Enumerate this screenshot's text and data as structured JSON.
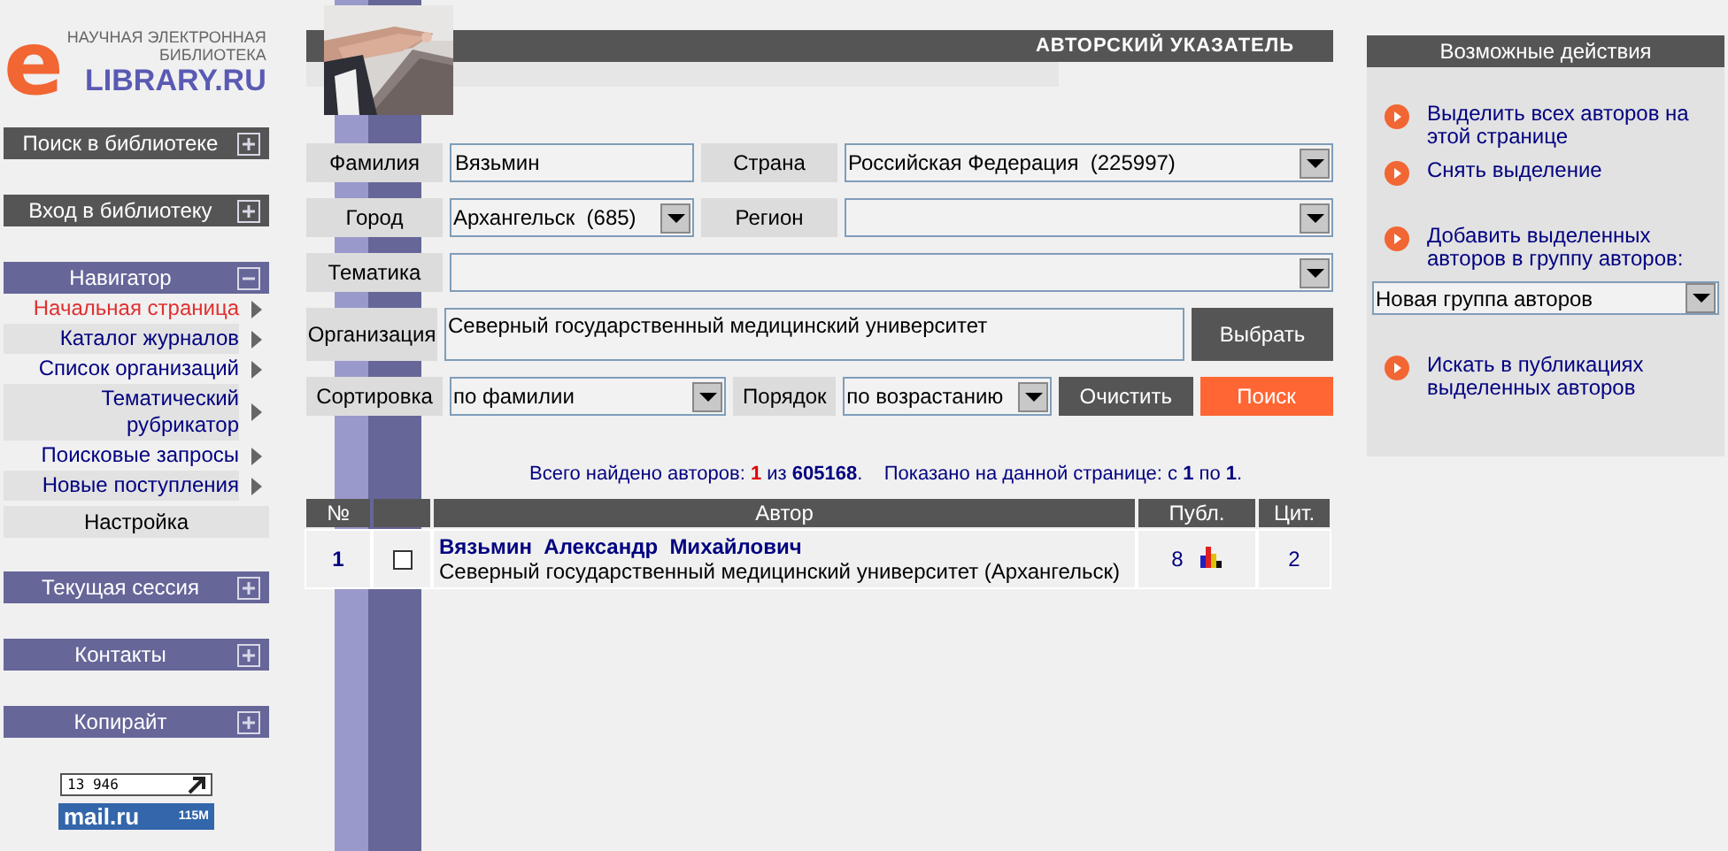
{
  "logo": {
    "letter": "e",
    "tagline_1": "НАУЧНАЯ ЭЛЕКТРОННАЯ",
    "tagline_2": "БИБЛИОТЕКА",
    "name": "LIBRARY.RU"
  },
  "sidebar": {
    "sections": [
      {
        "title": "Поиск в библиотеке",
        "expanded": false,
        "color": "#555555"
      },
      {
        "title": "Вход в библиотеку",
        "expanded": false,
        "color": "#555555"
      },
      {
        "title": "Навигатор",
        "expanded": true,
        "color": "#666699",
        "items": [
          {
            "label": "Начальная страница",
            "kind": "link",
            "selected": true
          },
          {
            "label": "Каталог журналов",
            "kind": "link",
            "selected": false
          },
          {
            "label": "Список организаций",
            "kind": "link",
            "selected": false
          },
          {
            "label": "Тематический рубрикатор",
            "kind": "link",
            "selected": false
          },
          {
            "label": "Поисковые запросы",
            "kind": "link",
            "selected": false
          },
          {
            "label": "Новые поступления",
            "kind": "link",
            "selected": false
          },
          {
            "label": "Настройка",
            "kind": "plain",
            "selected": false
          }
        ]
      },
      {
        "title": "Текущая сессия",
        "expanded": false,
        "color": "#666699"
      },
      {
        "title": "Контакты",
        "expanded": false,
        "color": "#666699"
      },
      {
        "title": "Копирайт",
        "expanded": false,
        "color": "#666699"
      }
    ],
    "counter": "13 946",
    "mail_logo": "mail.ru",
    "mail_count": "115M"
  },
  "page_title": "АВТОРСКИЙ УКАЗАТЕЛЬ",
  "form": {
    "rows": [
      {
        "fields": [
          {
            "label": "Фамилия",
            "kind": "text",
            "value": "Вязьмин"
          },
          {
            "label": "Страна",
            "kind": "select",
            "value": "Российская Федерация  (225997)"
          }
        ]
      },
      {
        "fields": [
          {
            "label": "Город",
            "kind": "select",
            "value": "Архангельск  (685)"
          },
          {
            "label": "Регион",
            "kind": "select"
          }
        ]
      },
      {
        "fields": [
          {
            "label": "Тематика",
            "kind": "select"
          }
        ]
      },
      {
        "fields": [
          {
            "label": "Организация",
            "kind": "textarea",
            "value": "Северный государственный медицинский университет"
          }
        ],
        "buttons": [
          {
            "label": "Выбрать",
            "kind": "dark"
          }
        ]
      },
      {
        "fields": [
          {
            "label": "Сортировка",
            "kind": "select",
            "value": "по фамилии"
          },
          {
            "label": "Порядок",
            "kind": "select",
            "value": "по возрастанию"
          }
        ],
        "buttons": [
          {
            "label": "Очистить",
            "kind": "dark"
          },
          {
            "label": "Поиск",
            "kind": "accent"
          }
        ]
      }
    ]
  },
  "summary": "Всего найдено авторов: **1** из **605168**.    Показано на данной странице: с **1** по **1**.",
  "table": {
    "columns": [
      "№",
      "Автор",
      "Публ.",
      "Цит."
    ],
    "rows": [
      {
        "number": "1",
        "checked": false,
        "name": "Вязьмин  Александр  Михайлович",
        "affiliation": "Северный государственный медицинский университет (Архангельск)",
        "publications": "8",
        "citations": "2"
      }
    ]
  },
  "actions": {
    "title": "Возможные действия",
    "groups": [
      [
        {
          "kind": "link",
          "text": "Выделить всех авторов на этой странице"
        },
        {
          "kind": "link",
          "text": "Снять выделение"
        }
      ],
      [
        {
          "kind": "link",
          "text": "Добавить выделенных авторов в группу авторов:"
        },
        {
          "kind": "select",
          "value": "Новая группа авторов"
        }
      ],
      [
        {
          "kind": "link",
          "text": "Искать в публикациях выделенных авторов"
        }
      ]
    ]
  }
}
